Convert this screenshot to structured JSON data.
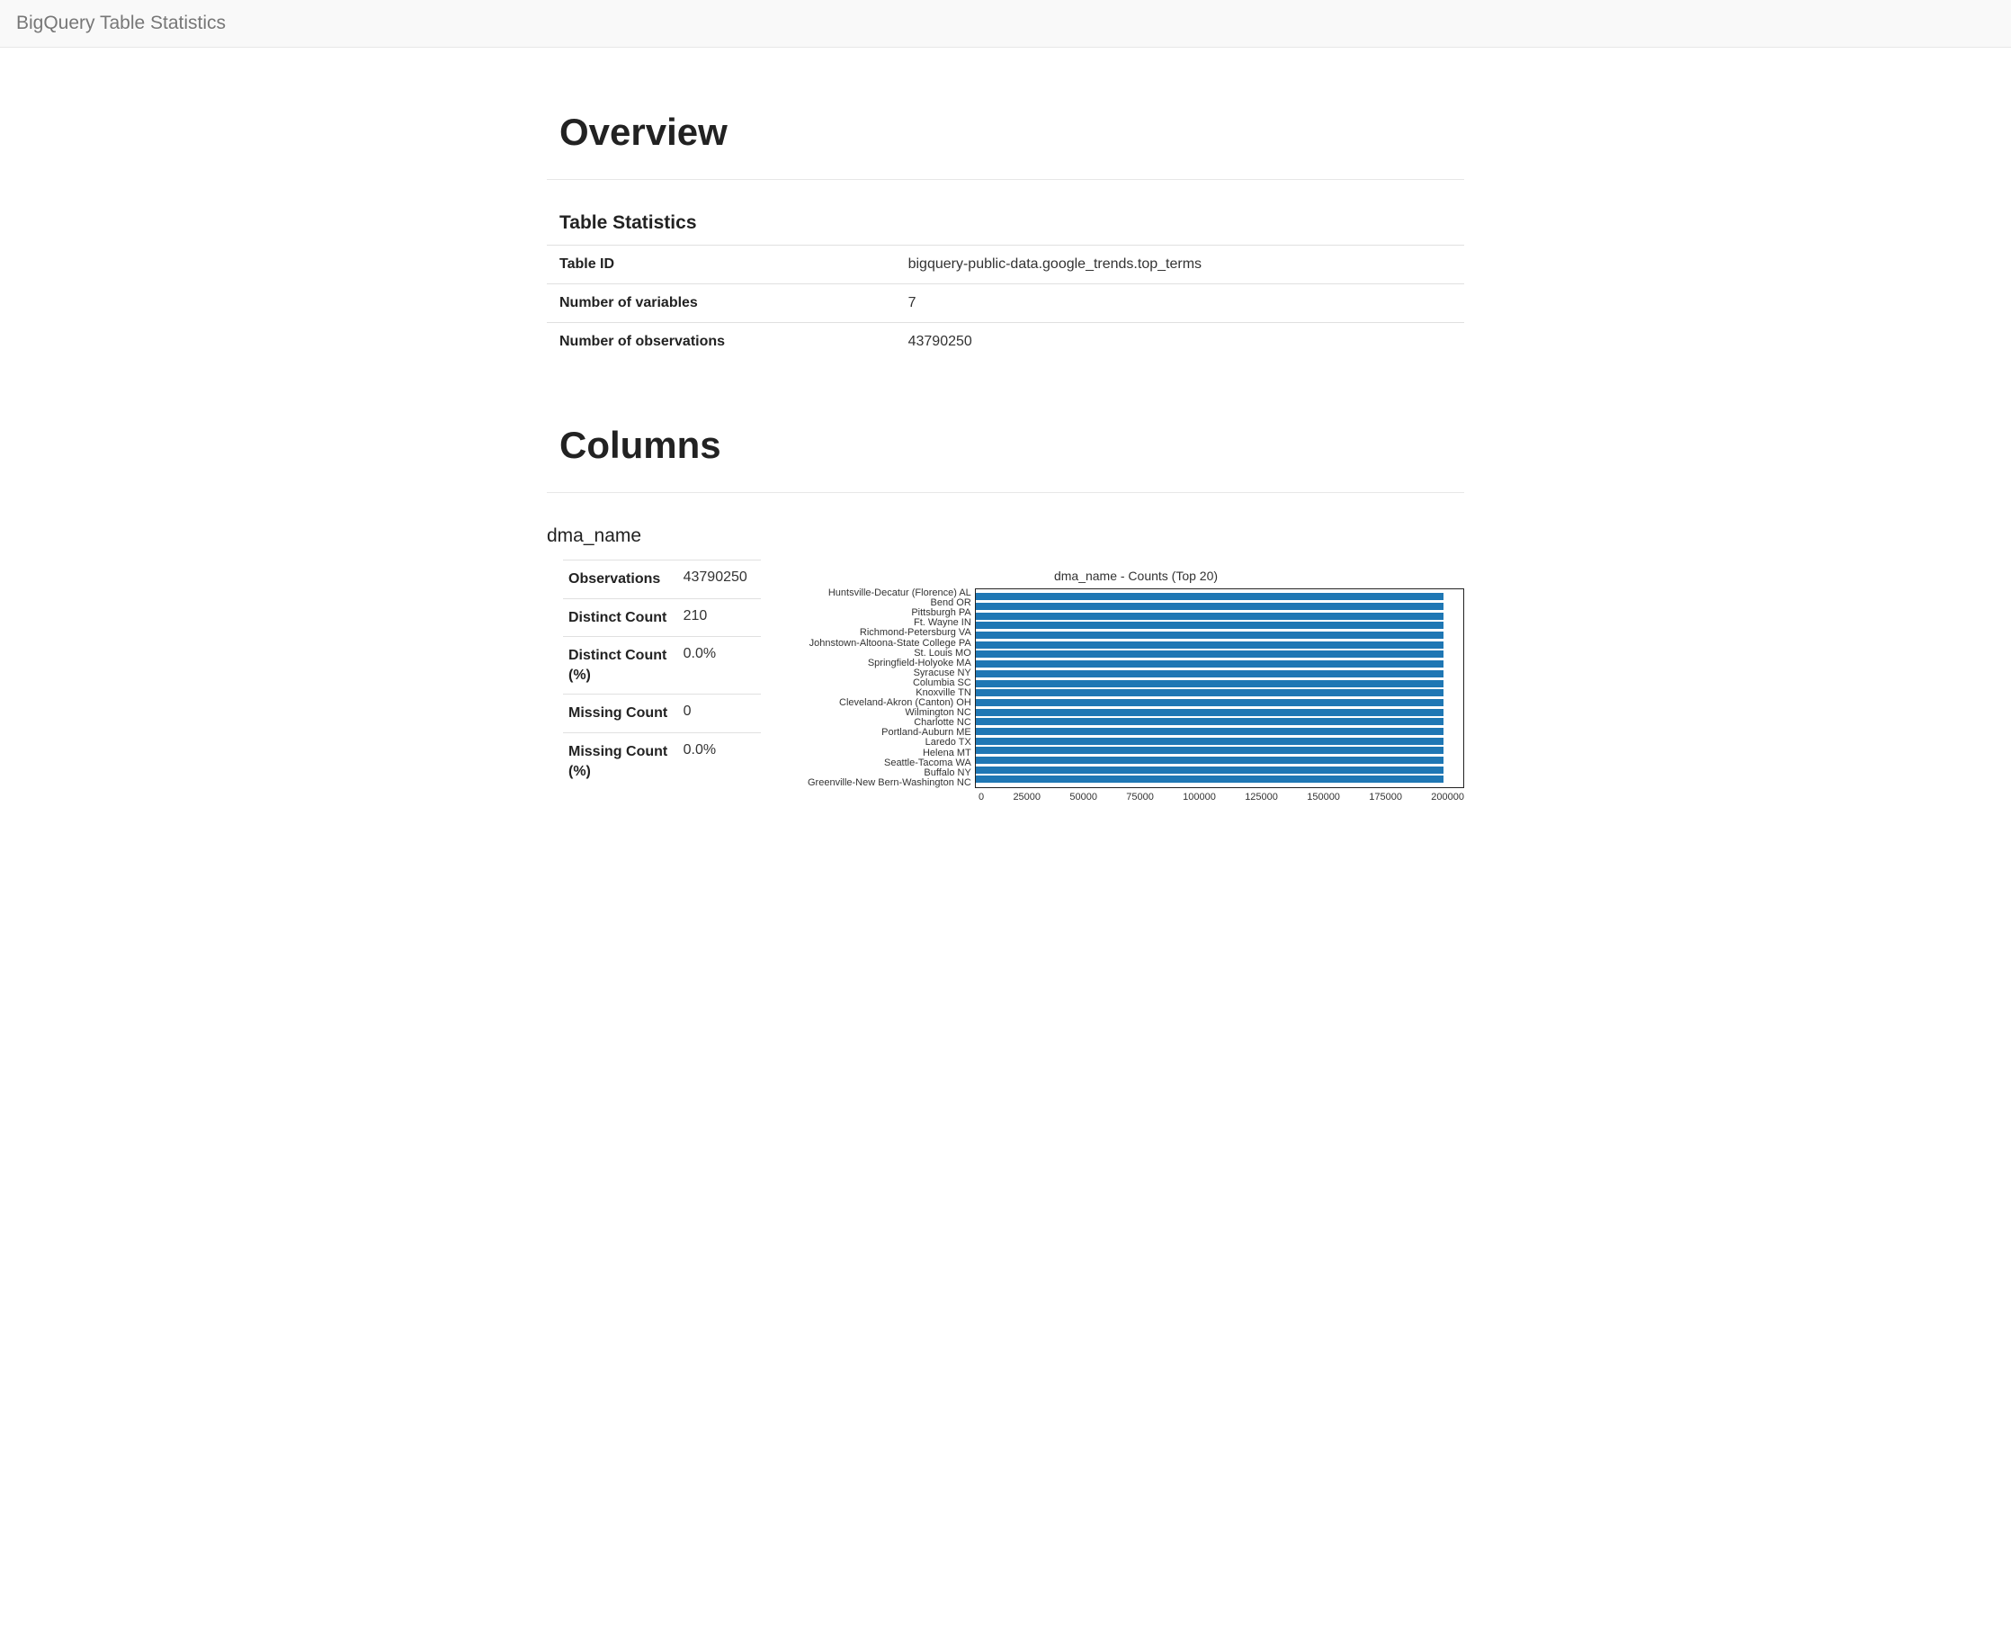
{
  "header": {
    "title": "BigQuery Table Statistics"
  },
  "overview": {
    "heading": "Overview",
    "subheading": "Table Statistics",
    "rows": [
      {
        "label": "Table ID",
        "value": "bigquery-public-data.google_trends.top_terms"
      },
      {
        "label": "Number of variables",
        "value": "7"
      },
      {
        "label": "Number of observations",
        "value": "43790250"
      }
    ]
  },
  "columns_section": {
    "heading": "Columns",
    "column": {
      "name": "dma_name",
      "stats": [
        {
          "label": "Observations",
          "value": "43790250"
        },
        {
          "label": "Distinct Count",
          "value": "210"
        },
        {
          "label": "Distinct Count (%)",
          "value": "0.0%"
        },
        {
          "label": "Missing Count",
          "value": "0"
        },
        {
          "label": "Missing Count (%)",
          "value": "0.0%"
        }
      ]
    }
  },
  "chart_data": {
    "type": "bar",
    "title": "dma_name - Counts (Top 20)",
    "xlabel": "",
    "ylabel": "",
    "xlim": [
      0,
      200000
    ],
    "x_ticks": [
      "0",
      "25000",
      "50000",
      "75000",
      "100000",
      "125000",
      "150000",
      "175000",
      "200000"
    ],
    "categories": [
      "Huntsville-Decatur (Florence) AL",
      "Bend OR",
      "Pittsburgh PA",
      "Ft. Wayne IN",
      "Richmond-Petersburg VA",
      "Johnstown-Altoona-State College PA",
      "St. Louis MO",
      "Springfield-Holyoke MA",
      "Syracuse NY",
      "Columbia SC",
      "Knoxville TN",
      "Cleveland-Akron (Canton) OH",
      "Wilmington NC",
      "Charlotte NC",
      "Portland-Auburn ME",
      "Laredo TX",
      "Helena MT",
      "Seattle-Tacoma WA",
      "Buffalo NY",
      "Greenville-New Bern-Washington NC"
    ],
    "values": [
      200000,
      200000,
      200000,
      200000,
      200000,
      200000,
      200000,
      200000,
      200000,
      200000,
      200000,
      200000,
      200000,
      200000,
      200000,
      200000,
      200000,
      200000,
      200000,
      200000
    ]
  }
}
